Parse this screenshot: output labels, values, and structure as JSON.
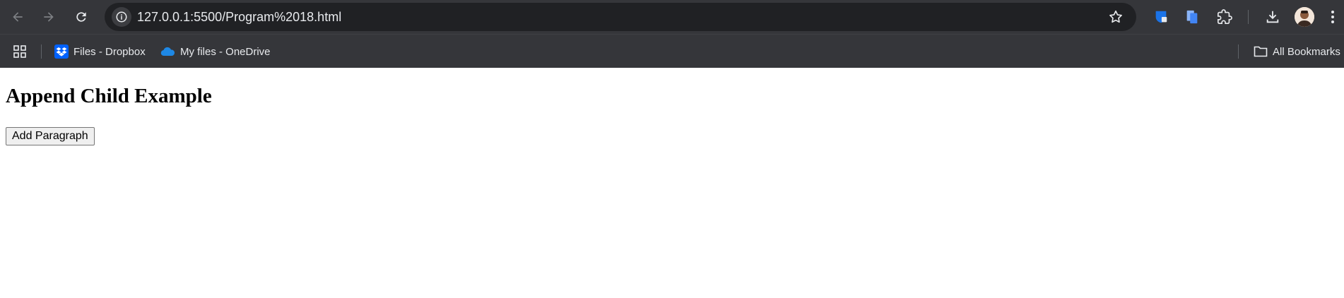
{
  "browser": {
    "url": "127.0.0.1:5500/Program%2018.html",
    "icons": {
      "back": "arrow-left-icon",
      "forward": "arrow-right-icon",
      "reload": "reload-icon",
      "site_info": "info-icon",
      "bookmark_star": "star-icon",
      "downloads": "download-icon",
      "menu": "kebab-menu-icon"
    }
  },
  "bookmarks_bar": {
    "items": [
      {
        "label": "Files - Dropbox",
        "icon": "dropbox-icon"
      },
      {
        "label": "My files - OneDrive",
        "icon": "onedrive-icon"
      }
    ],
    "all_bookmarks": "All Bookmarks"
  },
  "page": {
    "heading": "Append Child Example",
    "button_label": "Add Paragraph"
  },
  "colors": {
    "toolbar_bg": "#35363a",
    "omnibox_bg": "#202124",
    "dropbox_blue": "#0061fe",
    "onedrive_blue": "#1e88e5"
  }
}
